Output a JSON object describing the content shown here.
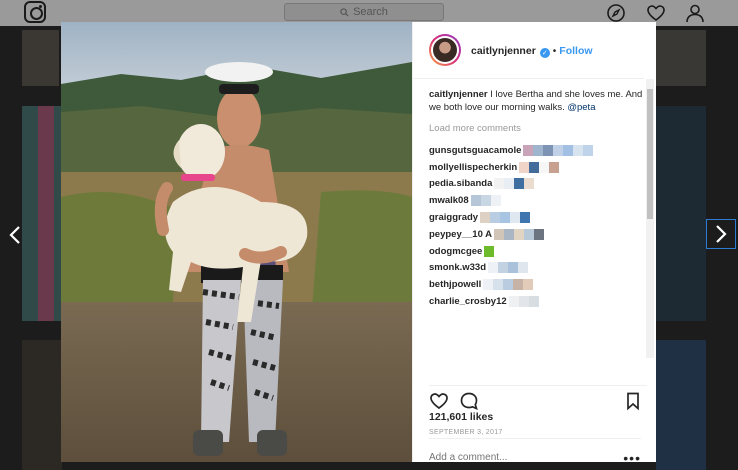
{
  "header": {
    "search_placeholder": "Search",
    "logo_icon": "instagram-icon",
    "explore_icon": "compass-icon",
    "activity_icon": "heart-icon",
    "profile_icon": "user-icon"
  },
  "post": {
    "username": "caitlynjenner",
    "follow_label": "Follow",
    "caption_user": "caitlynjenner",
    "caption_text": " I love Bertha and she loves me. And we both love our morning walks. ",
    "caption_mention": "@peta",
    "load_more": "Load more comments",
    "comments": [
      {
        "user": "gunsgutsguacamole",
        "blur_colors": [
          "#c9a3b8",
          "#9fb4cd",
          "#7d94b5",
          "#c0d0e6",
          "#a2c0e4",
          "#d7e3ef",
          "#bfd3ea"
        ]
      },
      {
        "user": "mollyellispecherkin",
        "blur_colors": [
          "#f1d4c8",
          "#446c9a",
          "#f6f6f6",
          "#c8a090"
        ]
      },
      {
        "user": "pedia.sibanda",
        "blur_colors": [
          "#f2f2f2",
          "#e8eef4",
          "#3f6fa0",
          "#eadccf"
        ]
      },
      {
        "user": "mwalk08",
        "blur_colors": [
          "#b5c6d9",
          "#c9d6e4",
          "#eef2f6"
        ]
      },
      {
        "user": "graiggrady",
        "blur_colors": [
          "#ddd1c3",
          "#b8cde2",
          "#a7c4e2",
          "#dfe8f1",
          "#3f76b0"
        ]
      },
      {
        "user": "peypey__10 A",
        "blur_colors": [
          "#d1c5b8",
          "#aab6c4",
          "#e2d4c2",
          "#b7c8d9",
          "#6b7480"
        ]
      },
      {
        "user": "odogmcgee",
        "blur_colors": [
          "#6dba2a"
        ]
      },
      {
        "user": "smonk.w33d",
        "blur_colors": [
          "#eef2f7",
          "#c2d2e2",
          "#a9c1da",
          "#dfe6ee"
        ]
      },
      {
        "user": "bethjpowell",
        "blur_colors": [
          "#eef2f7",
          "#d7e1ec",
          "#b9cce0",
          "#c7b3a6",
          "#e2cbb8"
        ]
      },
      {
        "user": "charlie_crosby12",
        "blur_colors": [
          "#eef0f2",
          "#e2e6ea",
          "#d8dde2"
        ]
      }
    ],
    "likes": "121,601 likes",
    "date": "SEPTEMBER 3, 2017",
    "add_comment_placeholder": "Add a comment...",
    "more_options": "•••"
  }
}
